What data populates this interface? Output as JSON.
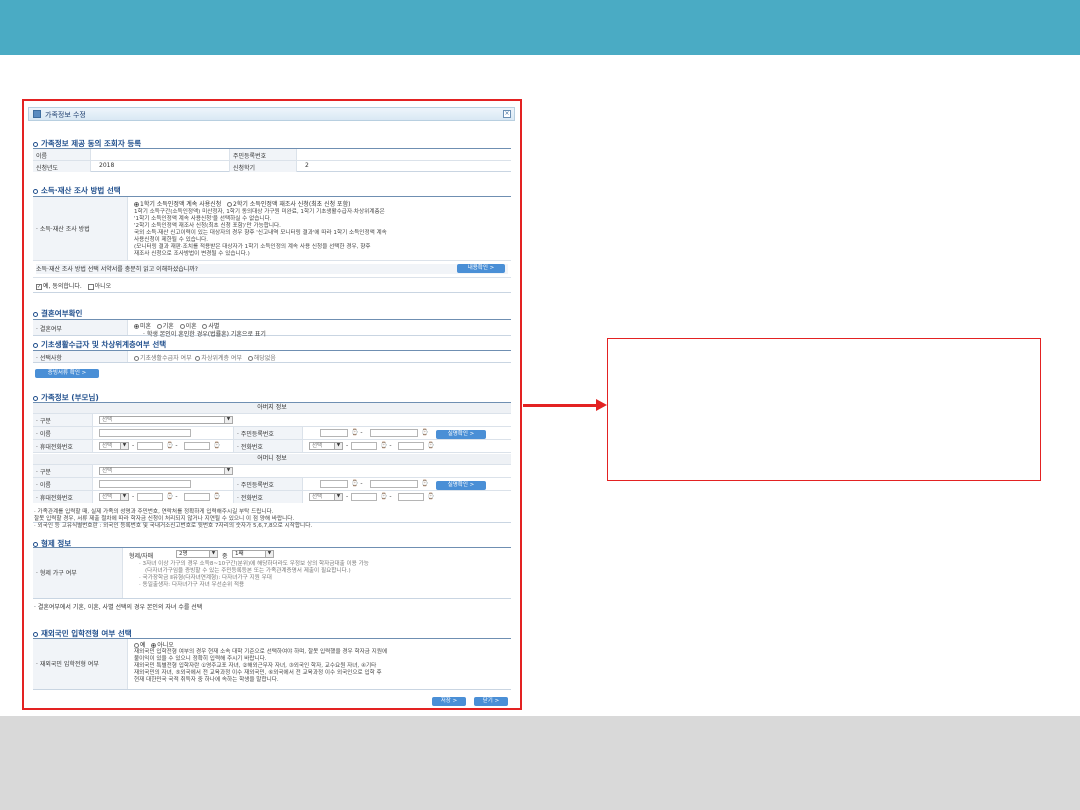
{
  "window": {
    "title": "가족정보 수정"
  },
  "sec1": {
    "title": "가족정보 제공 동의 조회자 등록",
    "name_label": "이름",
    "ssn_label": "주민등록번호",
    "year_label": "신청년도",
    "year_value": "2018",
    "term_label": "신청학기",
    "term_value": "2"
  },
  "sec2": {
    "title": "소득·재산 조사 방법 선택",
    "row_label": "소득·재산 조사 방법",
    "opt1": "1학기 소득인정액 계속 사용신청",
    "opt2": "2학기 소득인정액 재조사 신청(최초 신청 포함)",
    "red1": "1학기 소득구간(소득인정액) 미산정자, 1학기 동의대상 가구원 미완료, 1학기 기초생활수급자·차상위계층은",
    "red2": "'1학기 소득인정액 계속 사용신청'을 선택하실 수 없습니다.",
    "red3": "'2학기 소득인정액 재조사 신청(최초 신청 포함)'만 가능합니다.",
    "blue1": "국외 소득·재산 신고이력이 있는 대상자의 경우 향후 '신고내역 모니터링 결과'에 따라 1학기 소득인정액 계속",
    "blue2": "사용신청이 제한될 수 있습니다.",
    "blue3": "(모니터링 결과 재판·조치를 적용받은 대상자가 1학기 소득인정의 계속 사용 신청을 선택한 경우, 향후",
    "blue4": "재조사 신청으로 조사방법이 변경될 수 있습니다.)",
    "question": "소득·재산 조사 방법 선택 서약서를 충분히 읽고 이해하셨습니까?",
    "content_btn": "내용확인 >",
    "agree": "예, 동의합니다.",
    "disagree": "아니오"
  },
  "sec3": {
    "title": "결혼여부확인",
    "row_label": "결혼여부",
    "opts": [
      "미혼",
      "기혼",
      "이혼",
      "사별"
    ],
    "note": "· 학생 본인이 혼인한 경우(법률혼) 기혼으로 표기"
  },
  "sec4": {
    "title": "기초생활수급자 및 차상위계층여부 선택",
    "row_label": "선택사항",
    "opts": [
      "기초생활수급자 여부",
      "차상위계층 여부",
      "해당없음"
    ],
    "doc_btn": "증빙서류 확인 >"
  },
  "sec5": {
    "title": "가족정보 (부모님)",
    "father_head": "아버지 정보",
    "mother_head": "어머니 정보",
    "type_label": "구분",
    "type_value": "선택",
    "name_label": "이름",
    "ssn_label": "주민등록번호",
    "mobile_label": "휴대전화번호",
    "phone_label": "전화번호",
    "phone_sel": "선택",
    "verify_btn": "실명확인 >",
    "note1": "· 가족관계를 입력할 때, 실제 가족의 성명과 주민번호, 연락처를 정확하게 입력해주시길 부탁 드립니다.",
    "note2": "  잘못 입력할 경우, 서류 제출 절차에 따라 학자금 신청이 처리되지 않거나 지연될 수 있으니 이 점 양해 바랍니다.",
    "note3": "· 외국인 등 고유식별번호란 : 외국인 등록번호 및 국내거소신고번호로 뒷번호 7자리의 숫자가 5,6,7,8으로 시작합니다."
  },
  "sec6": {
    "title": "형제 정보",
    "row_label": "형제 가구 여부",
    "sibling_label": "형제/자매",
    "sibling_count": "2명",
    "of_label": "중",
    "order": "1째",
    "n1": "· 3자녀 이상 가구의 경우 소득8~10구간(분위)에 해당하더라도 우정보 상의 학자금대출 이용 가능",
    "n2": "(다자녀가구임을 증빙할 수 있는 주민등록등본 또는 가족관계증명서 제출이 필요합니다.)",
    "n3": "· 국가장학금 Ⅱ유형(다자녀연계형): 다자녀가구 지원 우대",
    "n4": "· 동일출생자: 다자녀가구 자녀 우선순위 적용",
    "bottom_note": "· 결혼여부에서 기혼, 이혼, 사별 선택의 경우 본인의 자녀 수를 선택"
  },
  "sec7": {
    "title": "재외국민 입학전형 여부 선택",
    "row_label": "재외국민 입학전형 여부",
    "yes": "예",
    "no": "아니오",
    "r1": "재외국민 입학전형 여부의 경우 현재 소속 대학 기준으로 선택하여야 하며, 잘못 입력했을 경우 학자금 지원에",
    "r2": "불이익이 있을 수 있으니 정확히 입력해 주시기 바랍니다.",
    "r3": "재외국민 특별전형 입학자란 ①영주교포 자녀, ②해외근무자 자녀, ③외국인 학자, 교수요원 자녀, ④기타",
    "r4": "재외국민의 자녀, ⑤외국에서 전 교육과정 이수 재외국민, ⑥외국에서 전 교육과정 이수 외국인으로 입학 후",
    "r5": "현재 대한민국 국적 취득자 중 하나에 속하는 학생을 말합니다."
  },
  "footer": {
    "save": "저장 >",
    "close": "닫기 >"
  }
}
